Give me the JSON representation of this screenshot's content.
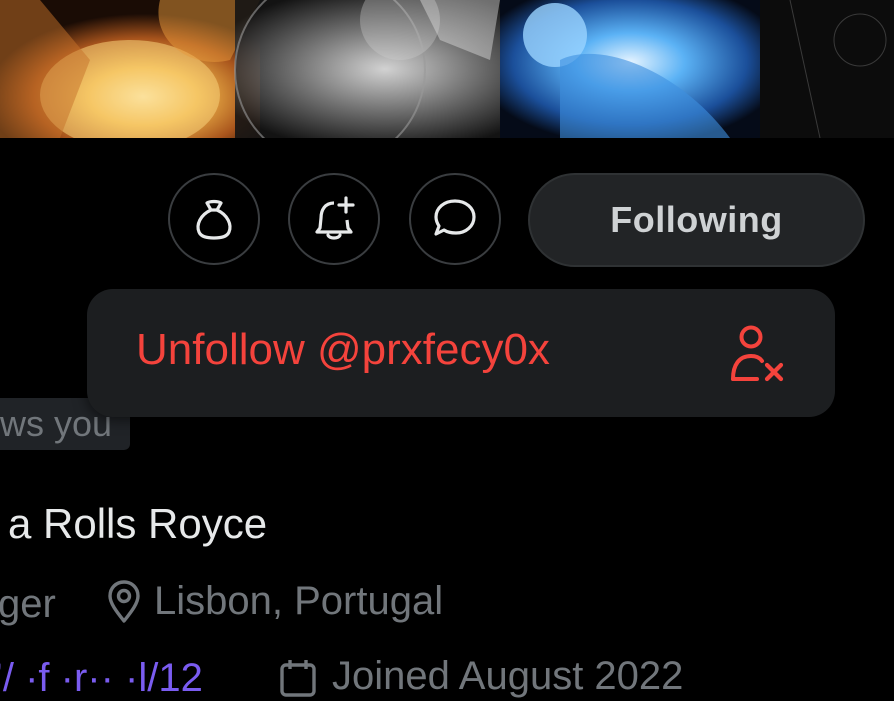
{
  "profile": {
    "follows_you_label": "ws you",
    "bio_text": "a Rolls Royce",
    "meta": {
      "left_fragment": "ger",
      "location": "Lisbon, Portugal"
    },
    "bottom": {
      "link_fragment": "’/ ·f ·r·· ·l/12",
      "joined_fragment": "Joined August 2022"
    }
  },
  "actions": {
    "following_label": "Following",
    "icons": [
      "moneybag-icon",
      "bell-plus-icon",
      "message-icon"
    ]
  },
  "menu": {
    "unfollow_label": "Unfollow @prxfecy0x",
    "unfollow_icon": "person-remove-icon",
    "accent_color": "#f4433c"
  },
  "colors": {
    "background": "#000000",
    "menu_bg": "#1c1e20",
    "button_bg": "#222426",
    "muted_text": "#71767b"
  }
}
